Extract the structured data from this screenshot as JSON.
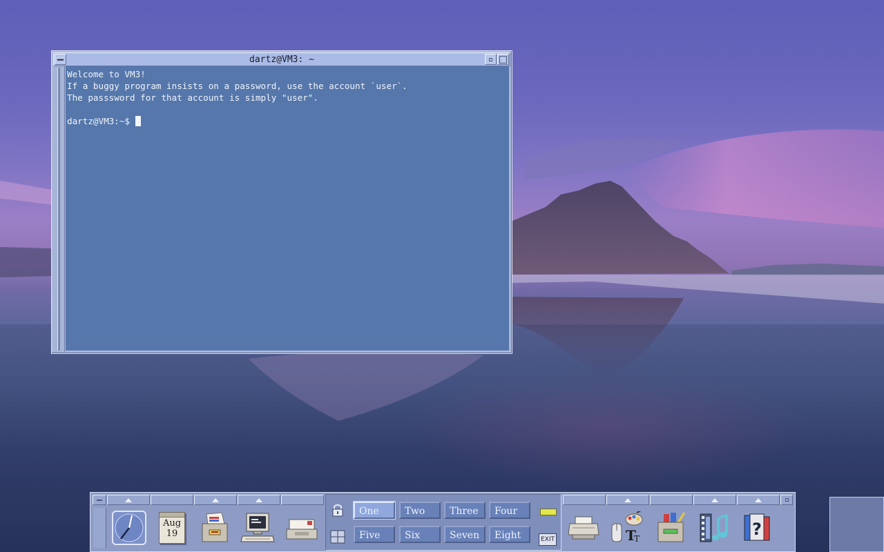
{
  "window": {
    "title": "dartz@VM3: ~",
    "terminal_lines": [
      "Welcome to VM3!",
      "If a buggy program insists on a password, use the account `user`.",
      "The passsword for that account is simply \"user\".",
      "",
      "dartz@VM3:~$ "
    ]
  },
  "panel": {
    "calendar": {
      "month": "Aug",
      "day": "19"
    },
    "workspaces": [
      "One",
      "Two",
      "Three",
      "Four",
      "Five",
      "Six",
      "Seven",
      "Eight"
    ],
    "active_workspace": "One",
    "exit_label": "EXIT",
    "icons": {
      "clock": "clock-icon",
      "calendar": "calendar-icon",
      "files": "file-manager-icon",
      "terminal": "terminal-computer-icon",
      "mail": "mail-icon",
      "lock": "lock-icon",
      "busy": "busy-indicator-icon",
      "printer": "printer-icon",
      "style": "style-manager-icon",
      "apps": "application-manager-icon",
      "media": "media-icon",
      "help": "help-icon"
    }
  },
  "colors": {
    "terminal_bg": "#5577ab",
    "titlebar": "#a9bbe6",
    "panel": "#8e9cc5"
  }
}
